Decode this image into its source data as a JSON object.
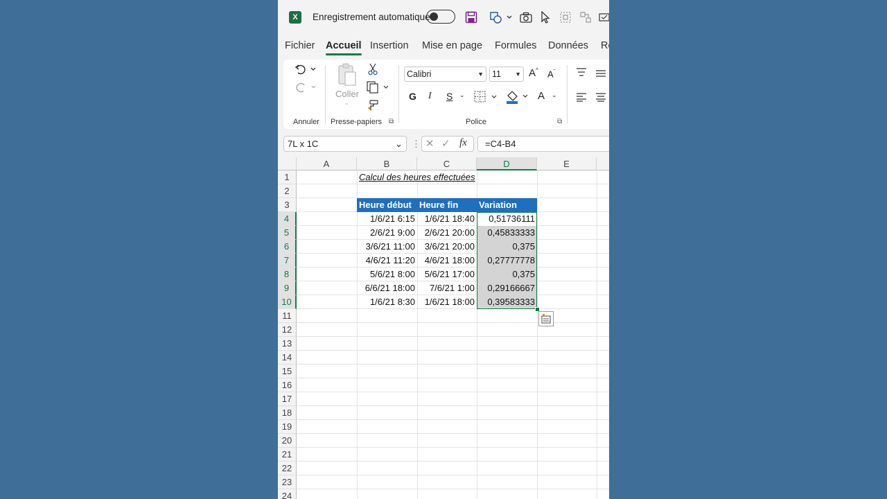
{
  "titlebar": {
    "logo_letter": "X",
    "autosave_label": "Enregistrement automatique"
  },
  "tabs": [
    {
      "label": "Fichier",
      "active": false
    },
    {
      "label": "Accueil",
      "active": true
    },
    {
      "label": "Insertion",
      "active": false
    },
    {
      "label": "Mise en page",
      "active": false
    },
    {
      "label": "Formules",
      "active": false
    },
    {
      "label": "Données",
      "active": false
    },
    {
      "label": "Ré",
      "active": false
    }
  ],
  "ribbon": {
    "groups": {
      "undo": "Annuler",
      "clipboard": "Presse-papiers",
      "font": "Police"
    },
    "paste_label": "Coller",
    "font_name": "Calibri",
    "font_size": "11",
    "bold": "G",
    "italic": "I",
    "underline": "S",
    "font_color_glyph": "A",
    "grow_font": "A",
    "shrink_font": "A"
  },
  "formula_bar": {
    "name_box": "7L x 1C",
    "fx_label": "fx",
    "formula": "=C4-B4"
  },
  "colors": {
    "accent": "#107c41",
    "header_fill": "#1f6fc0",
    "selection_fill": "#d4d4d4"
  },
  "sheet": {
    "columns": [
      "A",
      "B",
      "C",
      "D",
      "E"
    ],
    "rows": [
      "1",
      "2",
      "3",
      "4",
      "5",
      "6",
      "7",
      "8",
      "9",
      "10",
      "11",
      "12",
      "13",
      "14",
      "15",
      "16",
      "17",
      "18",
      "19",
      "20",
      "21",
      "22",
      "23",
      "24"
    ],
    "title": "Calcul des heures effectuées",
    "table_headers": [
      "Heure début",
      "Heure fin",
      "Variation"
    ],
    "table_rows": [
      [
        "1/6/21 6:15",
        "1/6/21 18:40",
        "0,51736111"
      ],
      [
        "2/6/21 9:00",
        "2/6/21 20:00",
        "0,45833333"
      ],
      [
        "3/6/21 11:00",
        "3/6/21 20:00",
        "0,375"
      ],
      [
        "4/6/21 11:20",
        "4/6/21 18:00",
        "0,27777778"
      ],
      [
        "5/6/21 8:00",
        "5/6/21 17:00",
        "0,375"
      ],
      [
        "6/6/21 18:00",
        "7/6/21 1:00",
        "0,29166667"
      ],
      [
        "1/6/21 8:30",
        "1/6/21 18:00",
        "0,39583333"
      ]
    ]
  }
}
